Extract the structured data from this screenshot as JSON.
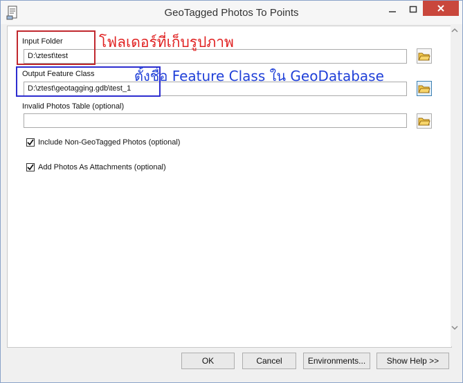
{
  "window": {
    "title": "GeoTagged Photos To Points"
  },
  "fields": {
    "input_folder": {
      "label": "Input Folder",
      "value": "D:\\ztest\\test"
    },
    "output_feature_class": {
      "label": "Output Feature Class",
      "value": "D:\\ztest\\geotagging.gdb\\test_1"
    },
    "invalid_photos_table": {
      "label": "Invalid Photos Table (optional)",
      "value": ""
    }
  },
  "checkboxes": {
    "include_non_geotagged": {
      "label": "Include Non-GeoTagged Photos (optional)",
      "checked": true
    },
    "add_photos_attachments": {
      "label": "Add Photos As Attachments (optional)",
      "checked": true
    }
  },
  "annotations": {
    "input_folder_note": "โฟลเดอร์ที่เก็บรูปภาพ",
    "output_note": "ตั้งชื่อ Feature Class ใน GeoDatabase"
  },
  "buttons": {
    "ok": "OK",
    "cancel": "Cancel",
    "environments": "Environments...",
    "show_help": "Show Help >>"
  },
  "icons": {
    "browse": "folder-browse-icon",
    "app": "toolbox-tool-icon"
  }
}
